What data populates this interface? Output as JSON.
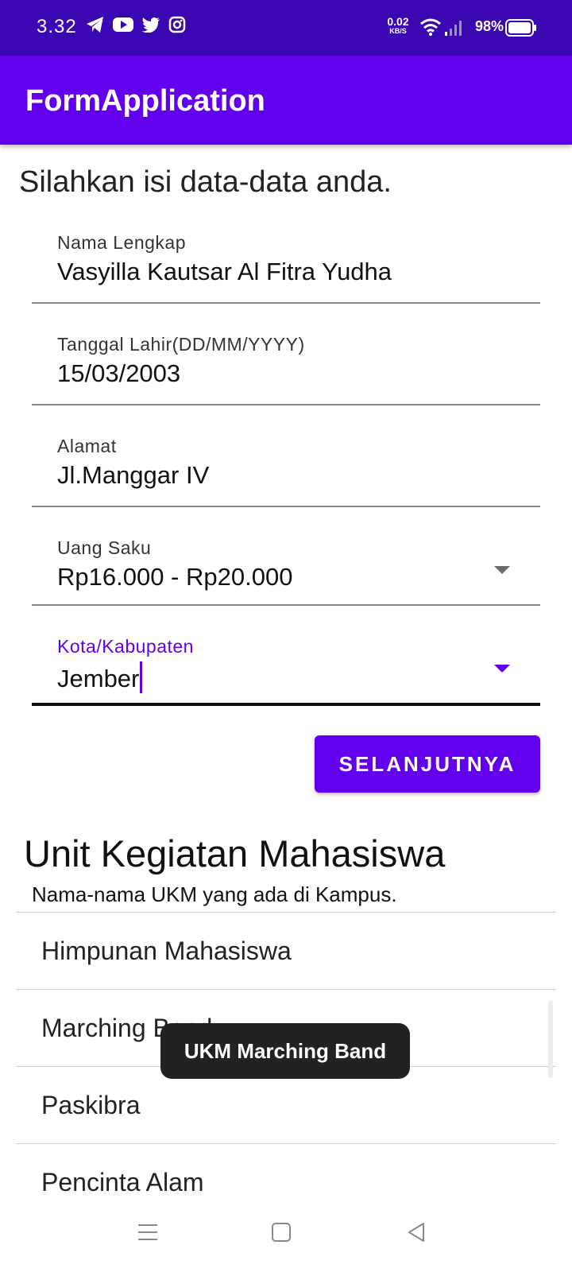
{
  "status_bar": {
    "time": "3.32",
    "net_speed_value": "0.02",
    "net_speed_unit": "KB/S",
    "battery_percent": "98%",
    "notification_icons": [
      "telegram-icon",
      "youtube-icon",
      "twitter-icon",
      "instagram-icon"
    ]
  },
  "app_bar": {
    "title": "FormApplication"
  },
  "form": {
    "intro": "Silahkan isi data-data anda.",
    "fields": [
      {
        "label": "Nama Lengkap",
        "value": "Vasyilla Kautsar Al Fitra Yudha"
      },
      {
        "label": "Tanggal Lahir(DD/MM/YYYY)",
        "value": "15/03/2003"
      },
      {
        "label": "Alamat",
        "value": "Jl.Manggar IV"
      },
      {
        "label": "Uang Saku",
        "value": "Rp16.000 - Rp20.000"
      },
      {
        "label": "Kota/Kabupaten",
        "value": "Jember"
      }
    ],
    "next_button": "SELANJUTNYA"
  },
  "ukm": {
    "title": "Unit Kegiatan Mahasiswa",
    "subtitle": "Nama-nama UKM yang ada di Kampus.",
    "items": [
      "Himpunan Mahasiswa",
      "Marching Band",
      "Paskibra",
      "Pencinta Alam"
    ]
  },
  "toast": {
    "message": "UKM Marching Band"
  },
  "colors": {
    "status_bar": "#3b07b3",
    "primary": "#6200ee",
    "toast_bg": "#222222"
  }
}
